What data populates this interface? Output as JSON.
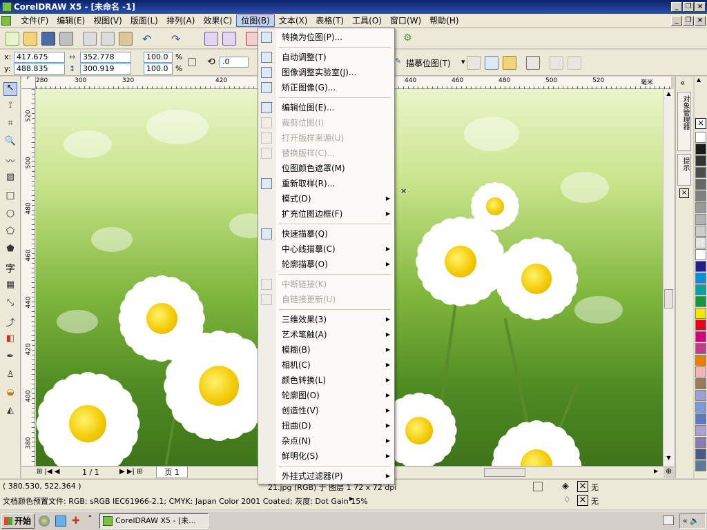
{
  "window": {
    "title": "CorelDRAW X5 - [未命名 -1]"
  },
  "menubar": {
    "items": [
      "文件(F)",
      "编辑(E)",
      "视图(V)",
      "版面(L)",
      "排列(A)",
      "效果(C)",
      "位图(B)",
      "文本(X)",
      "表格(T)",
      "工具(O)",
      "窗口(W)",
      "帮助(H)"
    ],
    "active_index": 6
  },
  "toolbar": {
    "x_label": "x:",
    "x_value": "417.675 mm",
    "y_label": "y:",
    "y_value": "488.835 mm",
    "w_value": "352.778 mm",
    "h_value": "300.919 mm",
    "scale_x": "100.0",
    "scale_y": "100.0",
    "percent": "%",
    "angle": ".0",
    "trace_label": "描摹位图(T)"
  },
  "ruler_top": [
    "280",
    "300",
    "320",
    "420",
    "440",
    "460",
    "480",
    "500",
    "520",
    "毫米"
  ],
  "ruler_left": [
    "520",
    "500",
    "480",
    "460",
    "440",
    "420",
    "400",
    "380"
  ],
  "dropdown": {
    "items": [
      {
        "label": "转换为位图(P)...",
        "disabled": false,
        "submenu": false,
        "icon": "convert-bitmap-icon"
      },
      {
        "label": "自动调整(T)",
        "disabled": false,
        "submenu": false,
        "icon": "auto-adjust-icon",
        "sep_before": true
      },
      {
        "label": "图像调整实验室(J)...",
        "disabled": false,
        "submenu": false,
        "icon": "image-lab-icon"
      },
      {
        "label": "矫正图像(G)...",
        "disabled": false,
        "submenu": false,
        "icon": "straighten-icon"
      },
      {
        "label": "编辑位图(E)...",
        "disabled": false,
        "submenu": false,
        "icon": "edit-bitmap-icon",
        "sep_before": true
      },
      {
        "label": "裁剪位图(I)",
        "disabled": true,
        "submenu": false,
        "icon": "crop-bitmap-icon"
      },
      {
        "label": "打开版样来源(U)",
        "disabled": true,
        "submenu": false,
        "icon": "open-trace-icon"
      },
      {
        "label": "替换版样(C)...",
        "disabled": true,
        "submenu": false,
        "icon": "replace-trace-icon"
      },
      {
        "label": "位图颜色遮罩(M)",
        "disabled": false,
        "submenu": false,
        "icon": ""
      },
      {
        "label": "重新取样(R)...",
        "disabled": false,
        "submenu": false,
        "icon": "resample-icon"
      },
      {
        "label": "模式(D)",
        "disabled": false,
        "submenu": true,
        "icon": ""
      },
      {
        "label": "扩充位图边框(F)",
        "disabled": false,
        "submenu": true,
        "icon": ""
      },
      {
        "label": "快速描摹(Q)",
        "disabled": false,
        "submenu": false,
        "icon": "quick-trace-icon",
        "sep_before": true
      },
      {
        "label": "中心线描摹(C)",
        "disabled": false,
        "submenu": true,
        "icon": ""
      },
      {
        "label": "轮廓描摹(O)",
        "disabled": false,
        "submenu": true,
        "icon": ""
      },
      {
        "label": "中断链接(K)",
        "disabled": true,
        "submenu": false,
        "icon": "break-link-icon",
        "sep_before": true
      },
      {
        "label": "自链接更新(U)",
        "disabled": true,
        "submenu": false,
        "icon": "update-link-icon"
      },
      {
        "label": "三维效果(3)",
        "disabled": false,
        "submenu": true,
        "icon": "",
        "sep_before": true
      },
      {
        "label": "艺术笔触(A)",
        "disabled": false,
        "submenu": true,
        "icon": ""
      },
      {
        "label": "模糊(B)",
        "disabled": false,
        "submenu": true,
        "icon": ""
      },
      {
        "label": "相机(C)",
        "disabled": false,
        "submenu": true,
        "icon": ""
      },
      {
        "label": "颜色转换(L)",
        "disabled": false,
        "submenu": true,
        "icon": ""
      },
      {
        "label": "轮廓图(O)",
        "disabled": false,
        "submenu": true,
        "icon": ""
      },
      {
        "label": "创造性(V)",
        "disabled": false,
        "submenu": true,
        "icon": ""
      },
      {
        "label": "扭曲(D)",
        "disabled": false,
        "submenu": true,
        "icon": ""
      },
      {
        "label": "杂点(N)",
        "disabled": false,
        "submenu": true,
        "icon": ""
      },
      {
        "label": "鲜明化(S)",
        "disabled": false,
        "submenu": true,
        "icon": ""
      },
      {
        "label": "外挂式过滤器(P)",
        "disabled": false,
        "submenu": true,
        "icon": "",
        "sep_before": true
      }
    ]
  },
  "pagebar": {
    "counter": "1 / 1",
    "page_tab": "页 1"
  },
  "status": {
    "coords": "( 380.530, 522.364 )",
    "object_info": "21.jpg (RGB) 于 图层 1 72 x 72 dpi",
    "color_profile": "文档颜色预置文件: RGB: sRGB IEC61966-2.1; CMYK: Japan Color 2001 Coated; 灰度: Dot Gain 15%",
    "fill_label": "无",
    "outline_label": "无"
  },
  "docker": {
    "tab1": "对象管理器",
    "tab2": "提示"
  },
  "palette": {
    "colors": [
      "#ffffff",
      "#1a1a1a",
      "#333333",
      "#4d4d4d",
      "#666666",
      "#808080",
      "#999999",
      "#b3b3b3",
      "#cccccc",
      "#e6e6e6",
      "#ffffff",
      "#1f1f8f",
      "#0a8fd6",
      "#0aa0a0",
      "#139a3c",
      "#f5e600",
      "#e6001a",
      "#d6007a",
      "#c43a8f",
      "#ef7d00",
      "#f5b5b5",
      "#9c7a5a",
      "#9aa0d0",
      "#7a9ad8",
      "#5a7ac0",
      "#b0a0d0",
      "#8a7ab0",
      "#4a5a8a",
      "#5a7a9a"
    ]
  },
  "taskbar": {
    "start": "开始",
    "task": "CorelDRAW X5 - [未..."
  }
}
